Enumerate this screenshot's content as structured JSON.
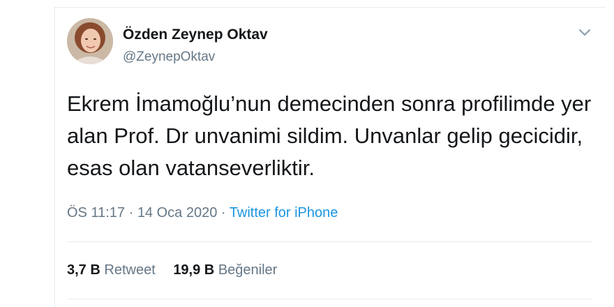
{
  "user": {
    "display_name": "Özden Zeynep Oktav",
    "handle": "@ZeynepOktav"
  },
  "tweet": {
    "text": "Ekrem İmamoğlu’nun demecinden sonra profilimde yer\nalan Prof. Dr unvanimi sildim. Unvanlar gelip gecicidir,\nesas olan vatanseverliktir.",
    "time": "ÖS 11:17",
    "separator1": " · ",
    "date": "14 Oca 2020",
    "separator2": " · ",
    "source": "Twitter for iPhone"
  },
  "stats": {
    "retweets_count": "3,7 B",
    "retweets_label": "Retweet",
    "likes_count": "19,9 B",
    "likes_label": "Beğeniler"
  },
  "icons": {
    "menu": "chevron-down-icon",
    "avatar": "profile-photo"
  },
  "colors": {
    "text_primary": "#14171a",
    "text_secondary": "#657786",
    "link": "#1b95e0",
    "border": "#e6ecf0"
  }
}
